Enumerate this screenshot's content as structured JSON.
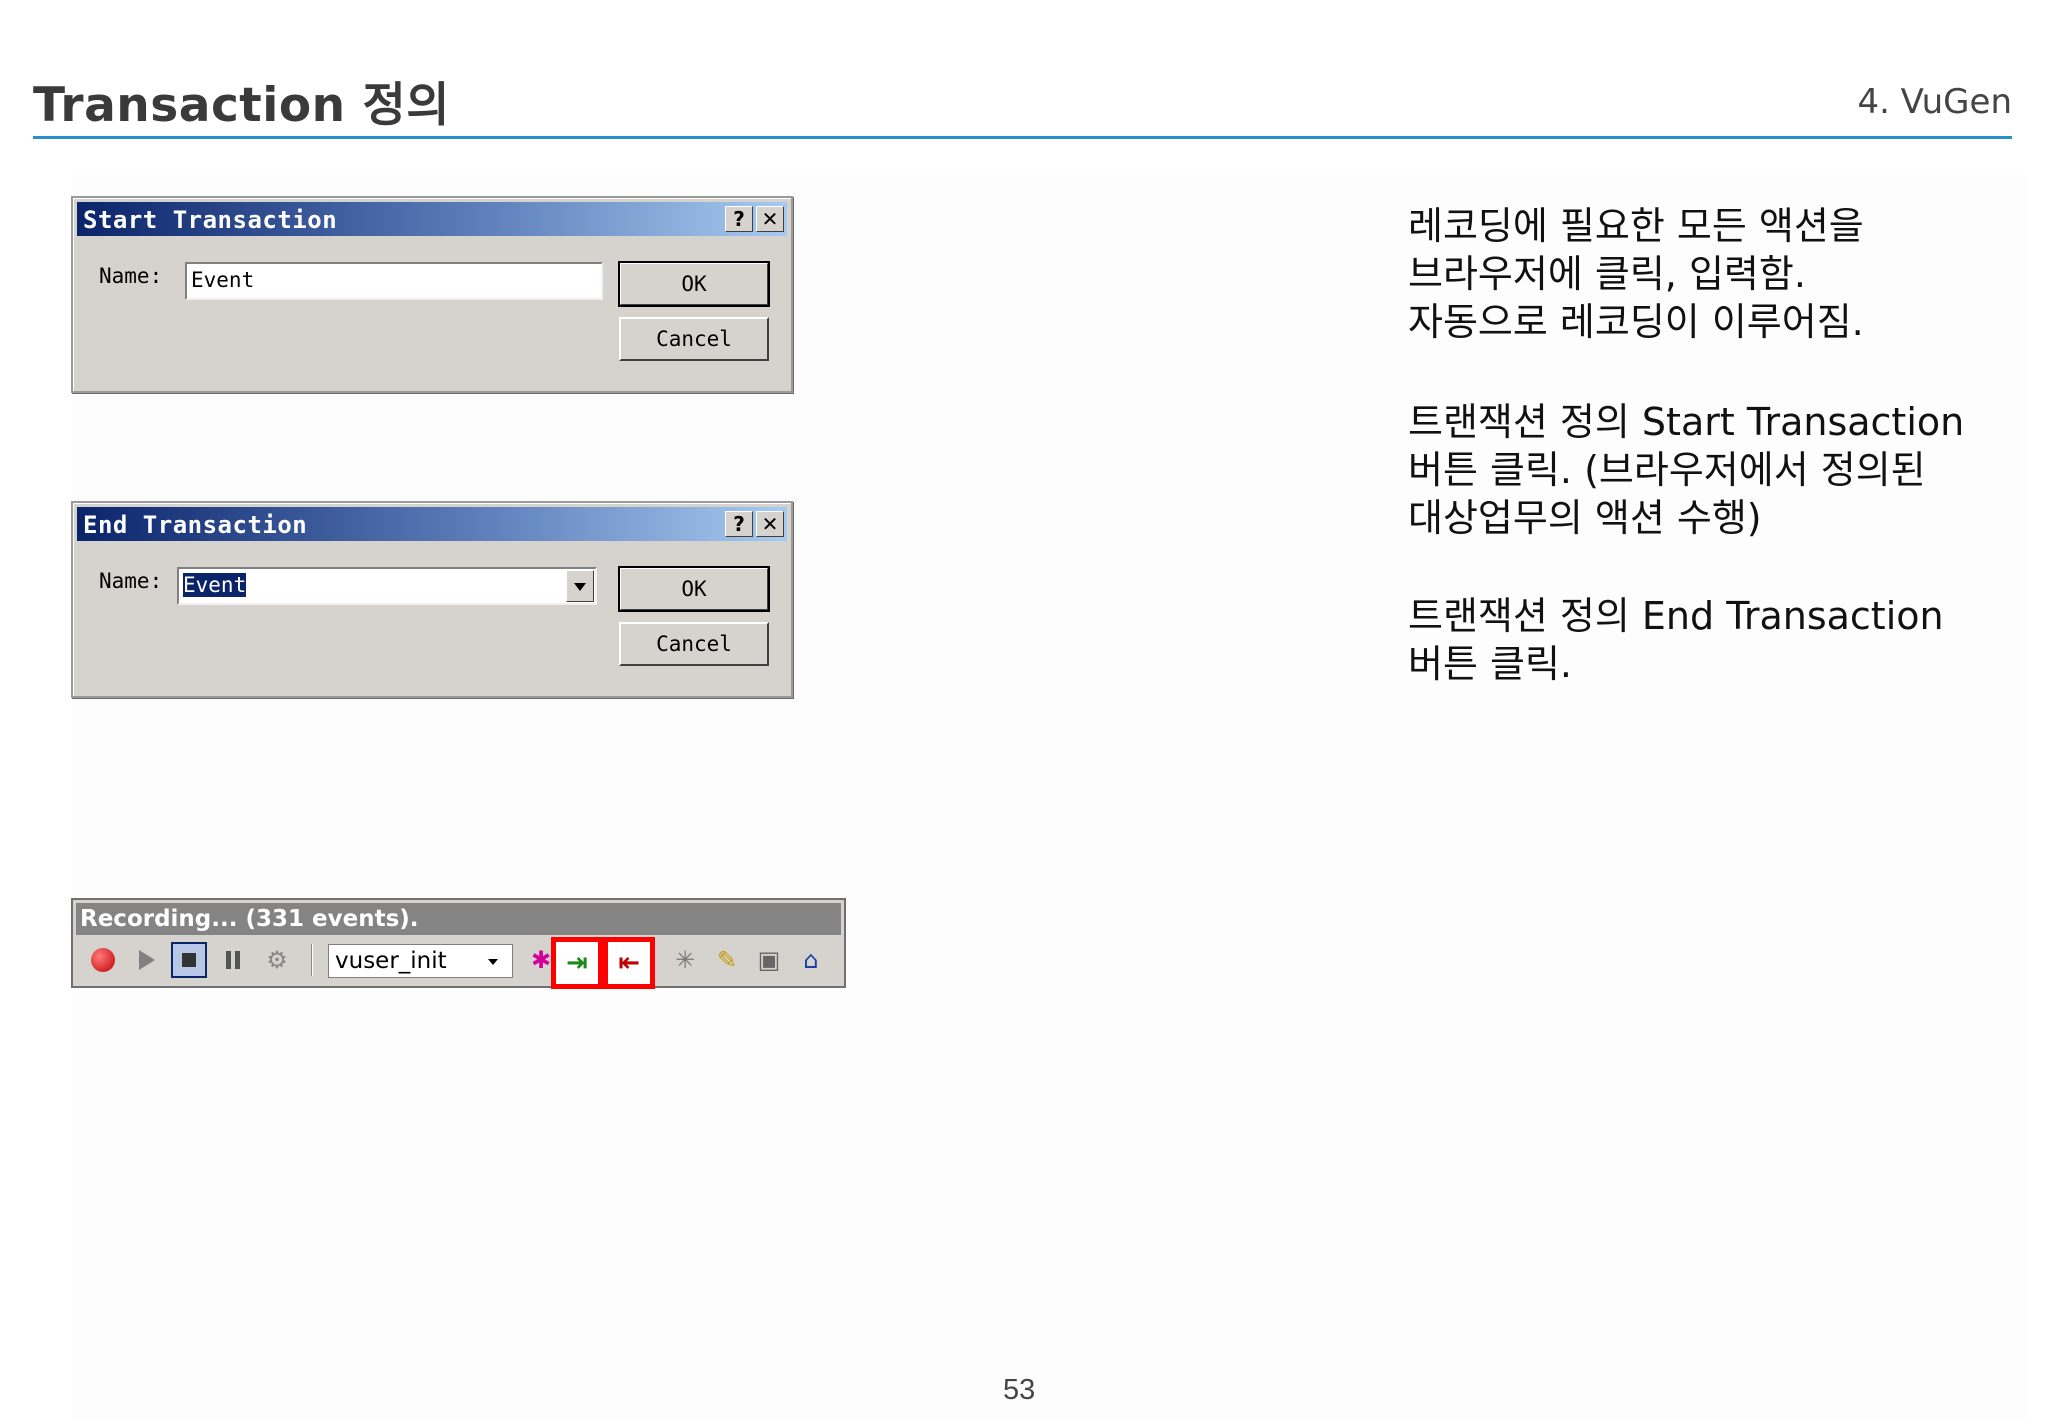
{
  "header": {
    "title": "Transaction 정의",
    "section": "4. VuGen"
  },
  "start_dialog": {
    "title": "Start Transaction",
    "help_label": "?",
    "close_label": "✕",
    "name_label": "Name:",
    "name_value": "Event",
    "ok_label": "OK",
    "cancel_label": "Cancel"
  },
  "end_dialog": {
    "title": "End Transaction",
    "help_label": "?",
    "close_label": "✕",
    "name_label": "Name:",
    "name_value": "Event",
    "ok_label": "OK",
    "cancel_label": "Cancel"
  },
  "recording_toolbar": {
    "status": "Recording... (331 events).",
    "action_select": "vuser_init",
    "icons": [
      "record-icon",
      "play-icon",
      "stop-icon",
      "pause-icon",
      "settings-icon",
      "insert-start-transaction-icon",
      "insert-end-transaction-icon",
      "rendezvous-icon",
      "comment-icon",
      "text-check-icon",
      "action-icon"
    ],
    "highlight_color": "#ff0000"
  },
  "description": {
    "para1": [
      "레코딩에 필요한 모든 액션을",
      "브라우저에 클릭, 입력함.",
      "자동으로 레코딩이 이루어짐."
    ],
    "para2": [
      "트랜잭션 정의 Start Transaction",
      "버튼 클릭. (브라우저에서 정의된",
      "대상업무의 액션 수행)"
    ],
    "para3": [
      "트랜잭션 정의 End Transaction",
      "버튼 클릭."
    ]
  },
  "footer": {
    "page_number": "53"
  },
  "colors": {
    "title_rule": "#2a8fc9",
    "titlebar_start": "#0a246a",
    "titlebar_end": "#a6caf0"
  }
}
